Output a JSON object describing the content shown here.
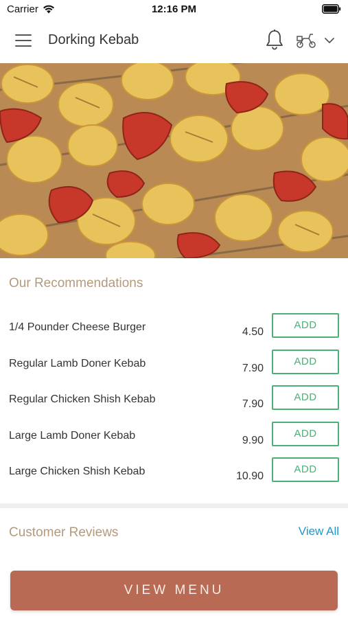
{
  "status_bar": {
    "carrier": "Carrier",
    "time": "12:16 PM"
  },
  "header": {
    "title": "Dorking Kebab",
    "icons": [
      "hamburger-menu-icon",
      "bell-icon",
      "scooter-icon",
      "chevron-down-icon"
    ]
  },
  "hero": {
    "description_icon": "kebab-photo"
  },
  "recommendations": {
    "title": "Our Recommendations",
    "add_label": "ADD",
    "items": [
      {
        "name": "1/4 Pounder Cheese Burger",
        "price": "4.50"
      },
      {
        "name": "Regular Lamb Doner Kebab",
        "price": "7.90"
      },
      {
        "name": "Regular Chicken Shish Kebab",
        "price": "7.90"
      },
      {
        "name": "Large Lamb Doner Kebab",
        "price": "9.90"
      },
      {
        "name": "Large Chicken Shish Kebab",
        "price": "10.90"
      }
    ]
  },
  "reviews": {
    "title": "Customer Reviews",
    "view_all": "View All"
  },
  "footer": {
    "view_menu": "VIEW MENU"
  },
  "colors": {
    "accent_green": "#4caf73",
    "section_title": "#b39a7c",
    "link_blue": "#2196c9",
    "primary_button": "#b86a55"
  }
}
